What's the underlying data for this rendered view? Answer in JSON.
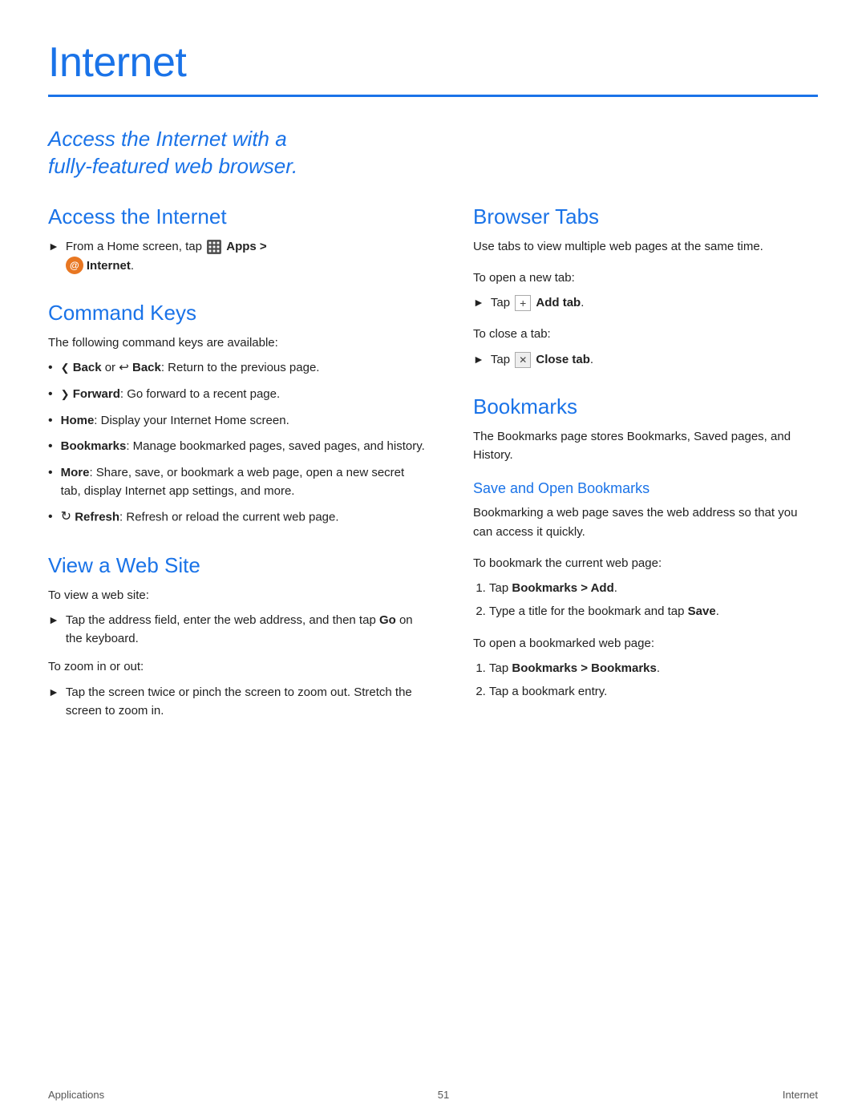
{
  "page": {
    "title": "Internet",
    "footer": {
      "left": "Applications",
      "center": "51",
      "right": "Internet"
    }
  },
  "tagline": {
    "line1": "Access the Internet with a",
    "line2": "fully-featured web browser."
  },
  "sections": {
    "access_internet": {
      "title": "Access the Internet",
      "step1": "From a Home screen, tap",
      "apps_label": "Apps >",
      "internet_label": "Internet",
      "internet_suffix": "."
    },
    "command_keys": {
      "title": "Command Keys",
      "intro": "The following command keys are available:",
      "items": [
        {
          "text": "Back or  Back: Return to the previous page.",
          "has_back_icon": true
        },
        {
          "text": "Forward: Go forward to a recent page.",
          "has_forward_icon": true
        },
        {
          "text": "Home: Display your Internet Home screen."
        },
        {
          "text": "Bookmarks: Manage bookmarked pages, saved pages, and history."
        },
        {
          "text": "More: Share, save, or bookmark a web page, open a new secret tab, display Internet app settings, and more."
        },
        {
          "text": "Refresh: Refresh or reload the current web page.",
          "has_refresh_icon": true
        }
      ]
    },
    "view_web_site": {
      "title": "View a Web Site",
      "intro1": "To view a web site:",
      "step1": "Tap the address field, enter the web address, and then tap Go on the keyboard.",
      "intro2": "To zoom in or out:",
      "step2": "Tap the screen twice or pinch the screen to zoom out. Stretch the screen to zoom in."
    },
    "browser_tabs": {
      "title": "Browser Tabs",
      "desc": "Use tabs to view multiple web pages at the same time.",
      "open_label": "To open a new tab:",
      "open_step": "Tap  Add tab.",
      "close_label": "To close a tab:",
      "close_step": "Tap  Close tab."
    },
    "bookmarks": {
      "title": "Bookmarks",
      "desc": "The Bookmarks page stores Bookmarks, Saved pages, and History.",
      "save_open_title": "Save and Open Bookmarks",
      "save_desc": "Bookmarking a web page saves the web address so that you can access it quickly.",
      "bookmark_label": "To bookmark the current web page:",
      "bookmark_steps": [
        "Tap Bookmarks > Add.",
        "Type a title for the bookmark and tap Save."
      ],
      "open_label": "To open a bookmarked web page:",
      "open_steps": [
        "Tap Bookmarks > Bookmarks.",
        "Tap a bookmark entry."
      ]
    }
  }
}
